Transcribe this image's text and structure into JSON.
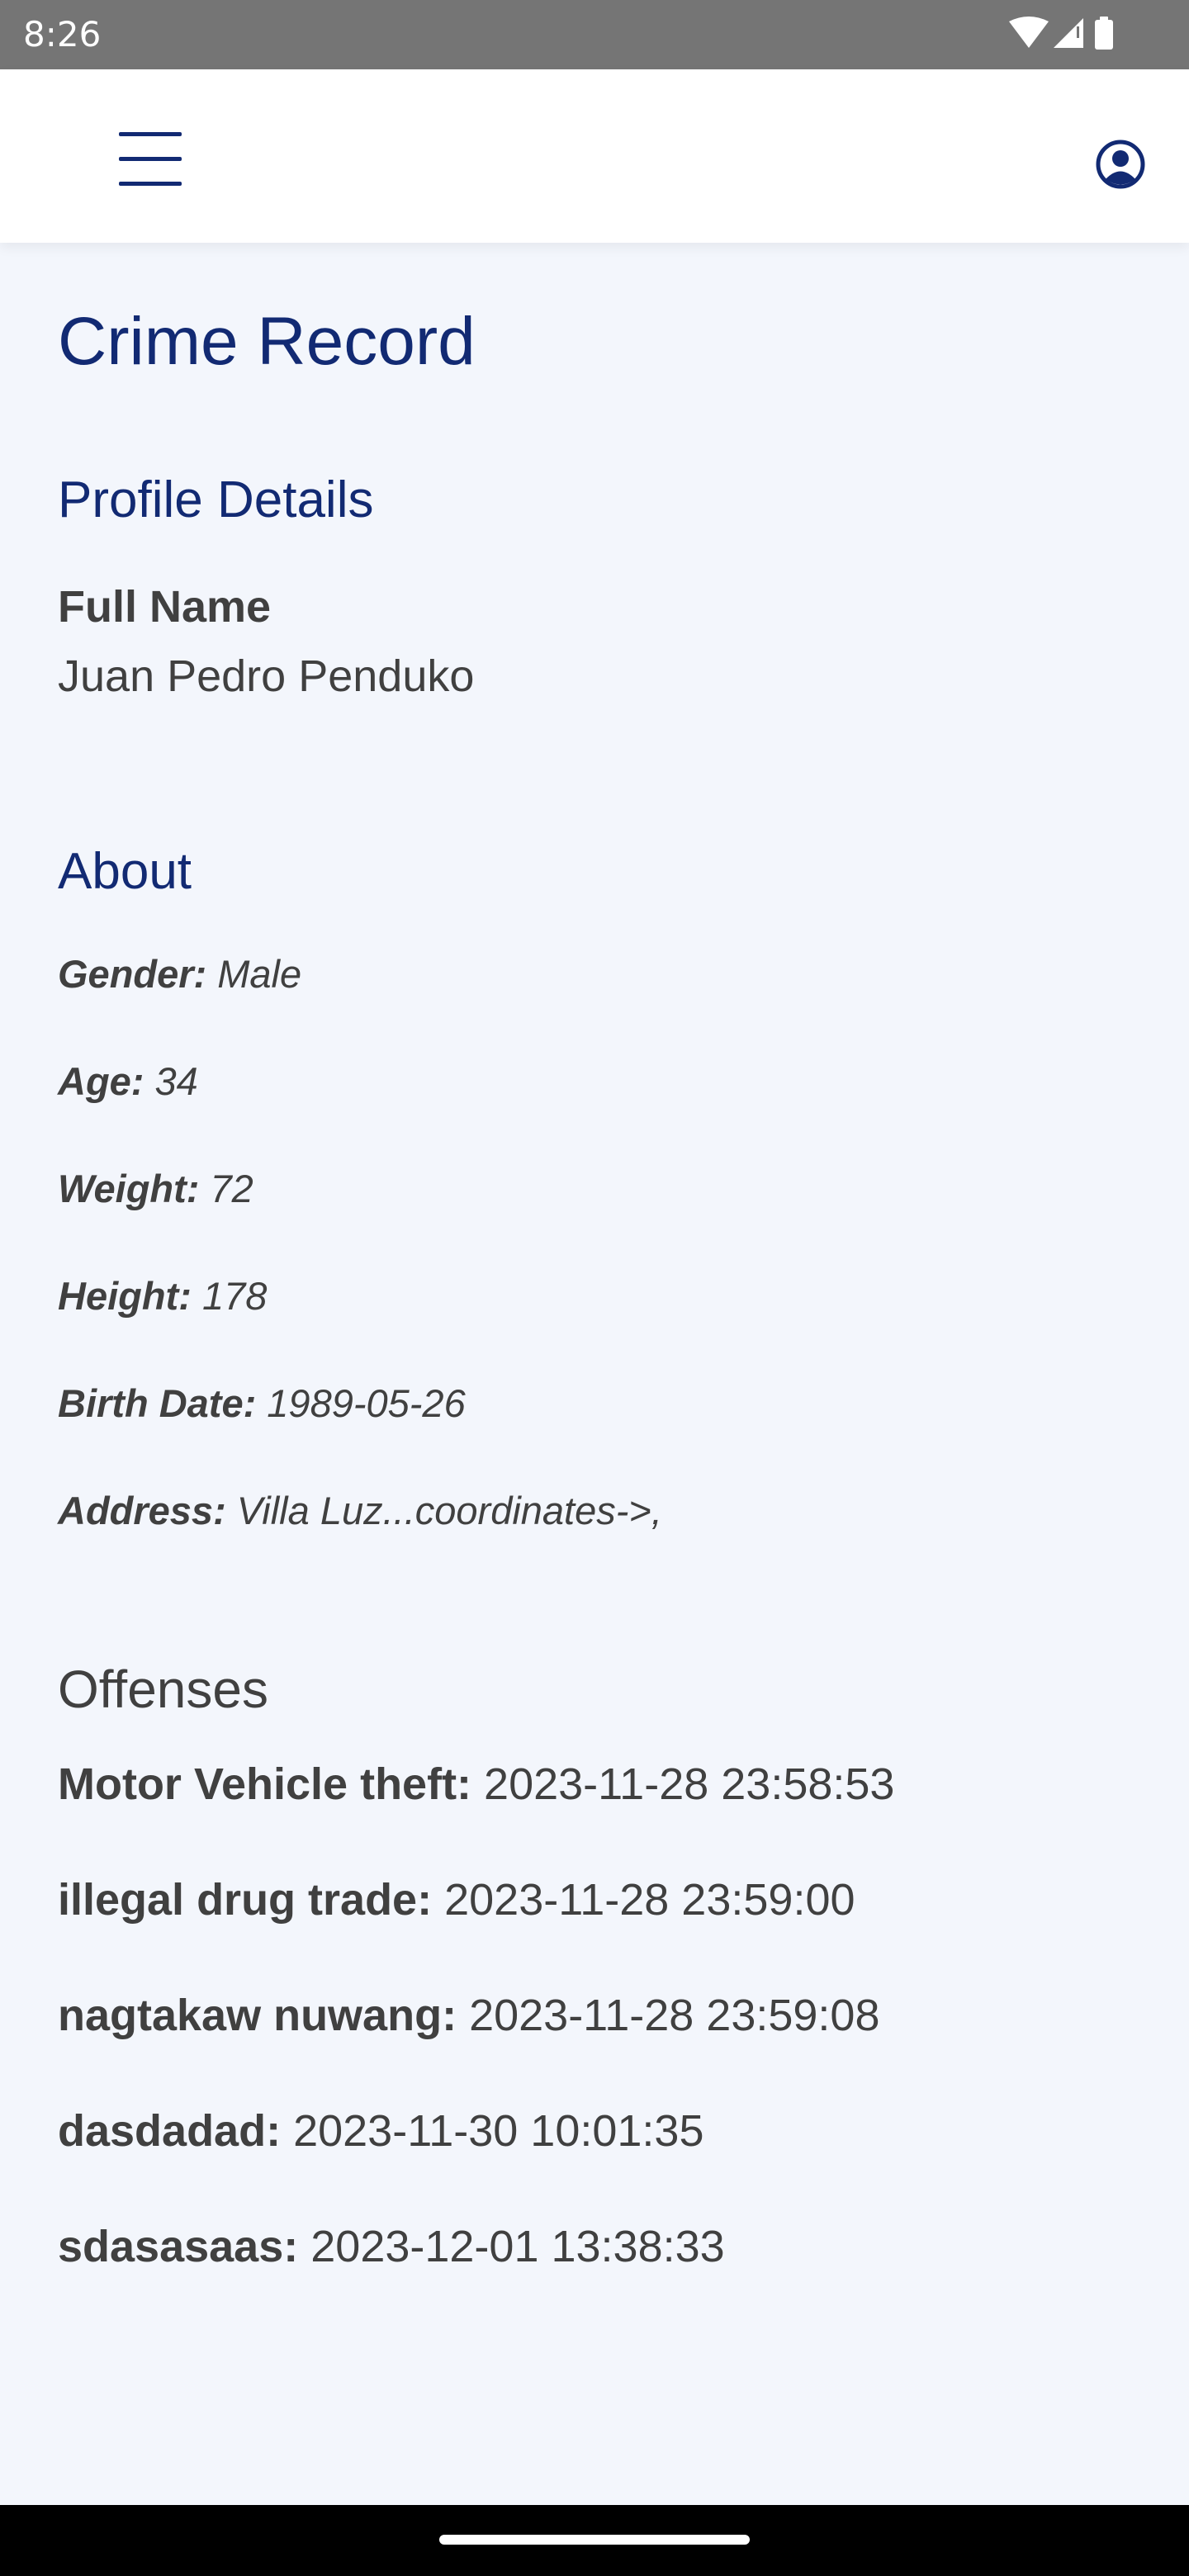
{
  "status_bar": {
    "time": "8:26",
    "icons": [
      "wifi-icon",
      "signal-icon",
      "battery-icon"
    ]
  },
  "app_bar": {
    "menu_icon": "hamburger-menu-icon",
    "account_icon": "account-circle-icon"
  },
  "page": {
    "title": "Crime Record"
  },
  "profile": {
    "heading": "Profile Details",
    "full_name_label": "Full Name",
    "full_name_value": "Juan Pedro Penduko"
  },
  "about": {
    "heading": "About",
    "fields": [
      {
        "label": "Gender:",
        "value": "Male"
      },
      {
        "label": "Age:",
        "value": "34"
      },
      {
        "label": "Weight:",
        "value": "72"
      },
      {
        "label": "Height:",
        "value": "178"
      },
      {
        "label": "Birth Date:",
        "value": "1989-05-26"
      },
      {
        "label": "Address:",
        "value": "Villa Luz...coordinates->,"
      }
    ]
  },
  "offenses": {
    "heading": "Offenses",
    "items": [
      {
        "name": "Motor Vehicle theft:",
        "datetime": "2023-11-28 23:58:53"
      },
      {
        "name": "illegal drug trade:",
        "datetime": "2023-11-28 23:59:00"
      },
      {
        "name": "nagtakaw nuwang:",
        "datetime": "2023-11-28 23:59:08"
      },
      {
        "name": "dasdadad:",
        "datetime": "2023-11-30 10:01:35"
      },
      {
        "name": "sdasasaas:",
        "datetime": "2023-12-01 13:38:33"
      }
    ]
  },
  "colors": {
    "accent": "#122a73",
    "text": "#404040",
    "background": "#f3f6fc",
    "status_bar": "#757575"
  }
}
